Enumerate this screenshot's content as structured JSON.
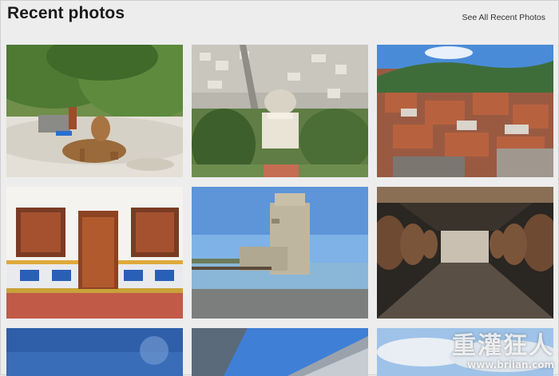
{
  "header": {
    "title": "Recent photos",
    "see_all_label": "See All Recent Photos"
  },
  "photos": [
    {
      "subject": "dog-on-beach"
    },
    {
      "subject": "city-domed-shrine-aerial"
    },
    {
      "subject": "hillside-red-roof-town"
    },
    {
      "subject": "white-house-wooden-door"
    },
    {
      "subject": "stone-tower-by-water"
    },
    {
      "subject": "wine-barrel-cellar"
    },
    {
      "subject": "blue-sky"
    },
    {
      "subject": "modern-building-sky"
    },
    {
      "subject": "clouds-sky"
    }
  ],
  "watermark": {
    "logo_text": "重灌狂人",
    "url": "www.briian.com"
  }
}
